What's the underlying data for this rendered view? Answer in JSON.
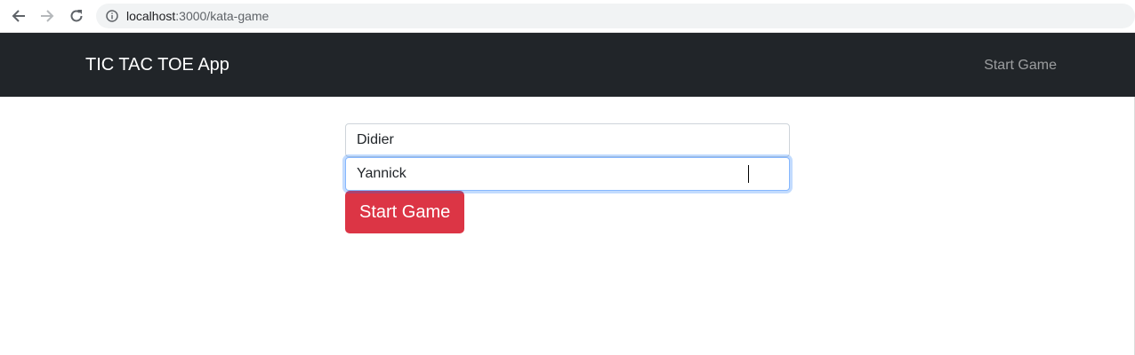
{
  "browser": {
    "url_host": "localhost",
    "url_path": ":3000/kata-game"
  },
  "navbar": {
    "brand": "TIC TAC TOE App",
    "link": "Start Game",
    "background": "#212529"
  },
  "form": {
    "player1_value": "Didier",
    "player2_value": "Yannick",
    "submit_label": "Start Game",
    "submit_color": "#dc3545"
  }
}
